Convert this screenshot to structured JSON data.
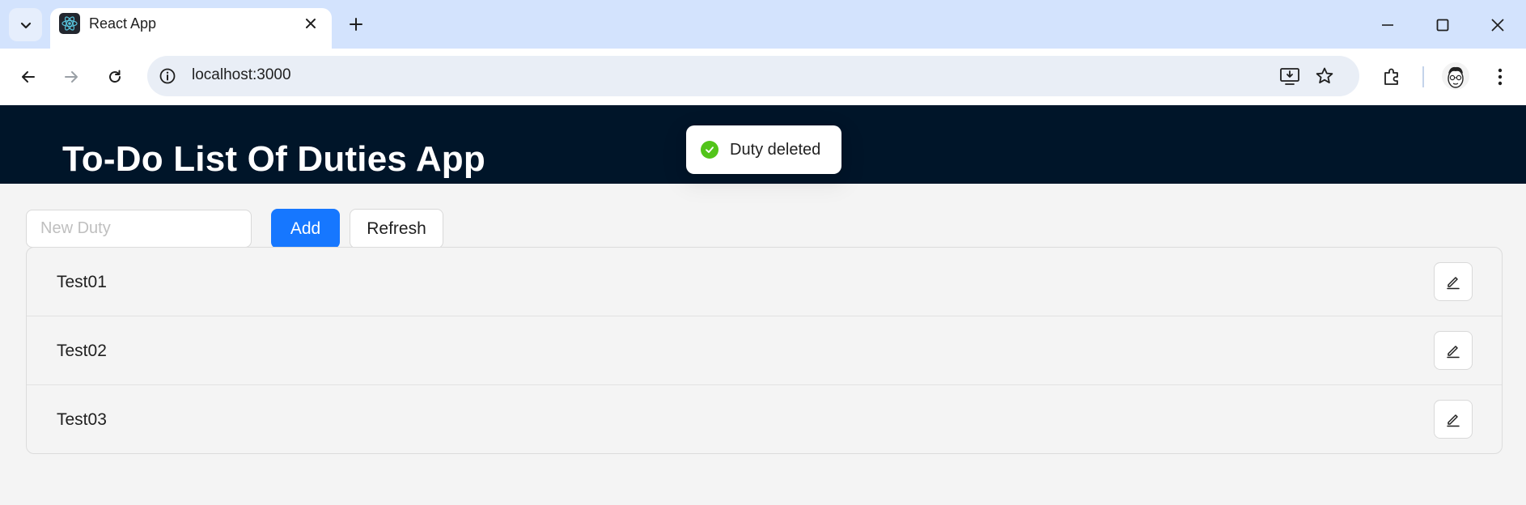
{
  "browser": {
    "tab": {
      "title": "React App",
      "favicon": "react-logo-icon"
    },
    "address": {
      "url": "localhost:3000"
    },
    "icons": {
      "tab_search": "chevron-down-icon",
      "close_tab": "close-icon",
      "new_tab": "plus-icon",
      "minimize": "minimize-icon",
      "maximize": "maximize-icon",
      "close_window": "close-icon",
      "back": "arrow-left-icon",
      "forward": "arrow-right-icon",
      "reload": "reload-icon",
      "site_info": "info-icon",
      "install": "install-app-icon",
      "bookmark": "star-icon",
      "extensions": "puzzle-icon",
      "profile": "avatar",
      "menu": "kebab-menu-icon"
    }
  },
  "app": {
    "title": "To-Do List Of Duties App",
    "header_color": "#001529"
  },
  "toast": {
    "message": "Duty deleted",
    "status": "success",
    "status_color": "#52c41a",
    "icon": "check-circle-icon"
  },
  "form": {
    "input_placeholder": "New Duty",
    "input_value": "",
    "add_label": "Add",
    "add_color": "#1677ff",
    "refresh_label": "Refresh"
  },
  "duties": [
    {
      "name": "Test01",
      "action_icon": "edit-icon"
    },
    {
      "name": "Test02",
      "action_icon": "edit-icon"
    },
    {
      "name": "Test03",
      "action_icon": "edit-icon"
    }
  ]
}
